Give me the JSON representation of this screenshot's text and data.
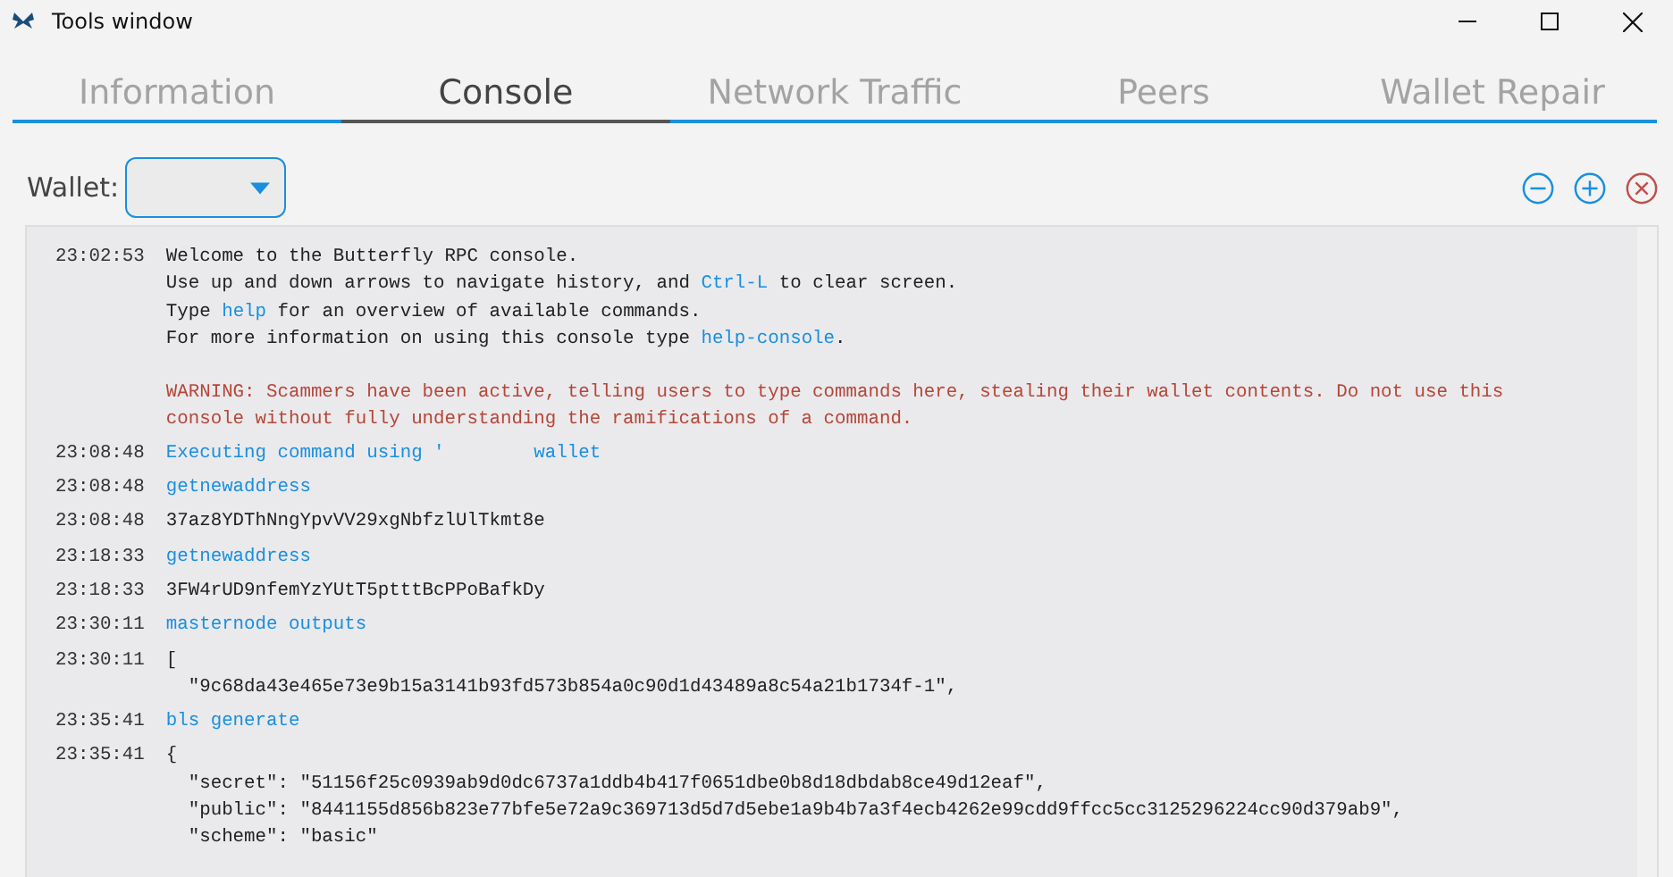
{
  "window": {
    "title": "Tools window"
  },
  "tabs": [
    {
      "label": "Information",
      "selected": false
    },
    {
      "label": "Console",
      "selected": true
    },
    {
      "label": "Network Traffic",
      "selected": false
    },
    {
      "label": "Peers",
      "selected": false
    },
    {
      "label": "Wallet Repair",
      "selected": false
    }
  ],
  "wallet": {
    "label": "Wallet:"
  },
  "console": [
    {
      "time": "23:02:53",
      "kind": "welcome",
      "lines": [
        [
          {
            "text": "Welcome to the Butterfly RPC console.",
            "highlight": false
          }
        ],
        [
          {
            "text": "Use up and down arrows to navigate history, and ",
            "highlight": false
          },
          {
            "text": "Ctrl-L",
            "highlight": true
          },
          {
            "text": " to clear screen.",
            "highlight": false
          }
        ],
        [
          {
            "text": "Type ",
            "highlight": false
          },
          {
            "text": "help",
            "highlight": true
          },
          {
            "text": " for an overview of available commands.",
            "highlight": false
          }
        ],
        [
          {
            "text": "For more information on using this console type ",
            "highlight": false
          },
          {
            "text": "help-console",
            "highlight": true
          },
          {
            "text": ".",
            "highlight": false
          }
        ]
      ],
      "warning": "WARNING: Scammers have been active, telling users to type commands here, stealing their wallet contents. Do not use this console without fully understanding the ramifications of a command."
    },
    {
      "time": "23:08:48",
      "kind": "command",
      "lines": [
        "Executing command using '        wallet"
      ]
    },
    {
      "time": "23:08:48",
      "kind": "command",
      "lines": [
        "getnewaddress"
      ]
    },
    {
      "time": "23:08:48",
      "kind": "reply",
      "lines": [
        "37az8YDThNngYpvVV29xgNbfzlUlTkmt8e"
      ]
    },
    {
      "time": "23:18:33",
      "kind": "command",
      "lines": [
        "getnewaddress"
      ]
    },
    {
      "time": "23:18:33",
      "kind": "reply",
      "lines": [
        "3FW4rUD9nfemYzYUtT5ptttBcPPoBafkDy"
      ]
    },
    {
      "time": "23:30:11",
      "kind": "command",
      "lines": [
        "masternode outputs"
      ]
    },
    {
      "time": "23:30:11",
      "kind": "reply",
      "lines": [
        "[",
        "  \"9c68da43e465e73e9b15a3141b93fd573b854a0c90d1d43489a8c54a21b1734f-1\","
      ]
    },
    {
      "time": "23:35:41",
      "kind": "command",
      "lines": [
        "bls generate"
      ]
    },
    {
      "time": "23:35:41",
      "kind": "reply",
      "lines": [
        "{",
        "  \"secret\": \"51156f25c0939ab9d0dc6737a1ddb4b417f0651dbe0b8d18dbdab8ce49d12eaf\",",
        "  \"public\": \"8441155d856b823e77bfe5e72a9c369713d5d7d5ebe1a9b4b7a3f4ecb4262e99cdd9ffcc5cc3125296224cc90d379ab9\",",
        "  \"scheme\": \"basic\""
      ]
    }
  ]
}
